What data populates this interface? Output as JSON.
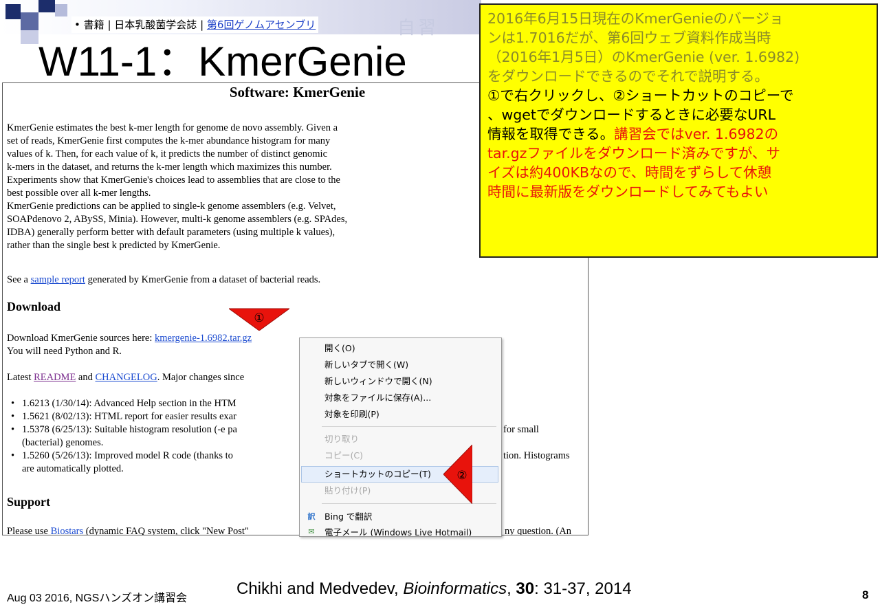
{
  "header": {
    "bullet": "•",
    "tag1": "書籍",
    "sep": "|",
    "tag2": "日本乳酸菌学会誌",
    "tag3": "第6回ゲノムアセンブリ",
    "watermark": "自習"
  },
  "slide_title": "W11-1：KmerGenie",
  "webpage": {
    "title": "Software: KmerGenie",
    "intro_lines": [
      "KmerGenie estimates the best k-mer length for genome de novo assembly. Given a",
      "set of reads, KmerGenie first computes the k-mer abundance histogram for many",
      "values of k. Then, for each value of k, it predicts the number of distinct genomic",
      "k-mers in the dataset, and returns the k-mer length which maximizes this number.",
      "Experiments show that KmerGenie's choices lead to assemblies that are close to the",
      "best possible over all k-mer lengths.",
      "KmerGenie predictions can be applied to single-k genome assemblers (e.g. Velvet,",
      "SOAPdenovo 2, ABySS, Minia). However, multi-k genome assemblers (e.g. SPAdes,",
      "IDBA) generally perform better with default parameters (using multiple k values),",
      "rather than the single best k predicted by KmerGenie."
    ],
    "see_a": "See a ",
    "sample_report": "sample report",
    "see_rest": " generated by KmerGenie from a dataset of bacterial reads.",
    "download_heading": "Download",
    "download_text": "Download KmerGenie sources here: ",
    "download_link": "kmergenie-1.6982.tar.gz",
    "need_text": "You will need Python and R.",
    "latest_a": "Latest ",
    "readme": "README",
    "and_text": " and ",
    "changelog": "CHANGELOG",
    "latest_rest": ". Major changes since",
    "changes": [
      {
        "a": "1.6213 (1/30/14): Advanced Help section in the HTM",
        "b": ""
      },
      {
        "a": "1.5621 (8/02/13): HTML report for easier results exar",
        "b": ""
      },
      {
        "a": "1.5378 (6/25/13): Suitable histogram resolution (-e pa",
        "b": "for small"
      },
      {
        "a": "(bacterial) genomes.",
        "b": ""
      },
      {
        "a": "1.5260 (5/26/13): Improved model R code (thanks to",
        "b": "tion. Histograms"
      },
      {
        "a": "are automatically plotted.",
        "b": ""
      }
    ],
    "support_heading": "Support",
    "support_a": "Please use ",
    "biostars": "Biostars",
    "support_b": " (dynamic FAQ system, click \"New Post\"",
    "support_c": "ny question. (An"
  },
  "context_menu": {
    "items": [
      {
        "label": "開く(O)",
        "enabled": true
      },
      {
        "label": "新しいタブで開く(W)",
        "enabled": true
      },
      {
        "label": "新しいウィンドウで開く(N)",
        "enabled": true
      },
      {
        "label": "対象をファイルに保存(A)...",
        "enabled": true
      },
      {
        "label": "対象を印刷(P)",
        "enabled": true
      },
      {
        "label": "切り取り",
        "enabled": false
      },
      {
        "label": "コピー(C)",
        "enabled": false
      },
      {
        "label": "ショートカットのコピー(T)",
        "enabled": true,
        "highlighted": true
      },
      {
        "label": "貼り付け(P)",
        "enabled": false
      },
      {
        "label": "Bing で翻訳",
        "enabled": true,
        "icon": "translate-icon"
      },
      {
        "label": "電子メール (Windows Live Hotmail)",
        "enabled": true,
        "icon": "email-icon"
      }
    ]
  },
  "markers": {
    "one": "①",
    "two": "②"
  },
  "callout": {
    "line1": "2016年6月15日現在のKmerGenieのバージョ",
    "line2": "ンは1.7016だが、第6回ウェブ資料作成当時",
    "line3": "（2016年1月5日）のKmerGenie (ver. 1.6982)",
    "line4": "をダウンロードできるのでそれで説明する。",
    "line5": "①で右クリックし、②ショートカットのコピーで",
    "line6": "、wgetでダウンロードするときに必要なURL",
    "line7a": "情報を取得できる。",
    "line7b": "講習会ではver. 1.6982の",
    "line8": "tar.gzファイルをダウンロード済みですが、サ",
    "line9": "イズは約400KBなので、時間をずらして休憩",
    "line10": "時間に最新版をダウンロードしてみてもよい"
  },
  "footer": {
    "date_event": "Aug 03 2016, NGSハンズオン講習会",
    "cite_authors": "Chikhi and Medvedev, ",
    "cite_journal": "Bioinformatics",
    "cite_sep": ", ",
    "cite_volume": "30",
    "cite_pages": ": 31-37, 2014",
    "page_number": "8"
  },
  "colors": {
    "callout_bg": "#ffff00",
    "callout_red": "#e8130c",
    "arrow_red": "#e8130c",
    "link_blue": "#1a4ad0",
    "link_visited": "#7b2e8e"
  }
}
